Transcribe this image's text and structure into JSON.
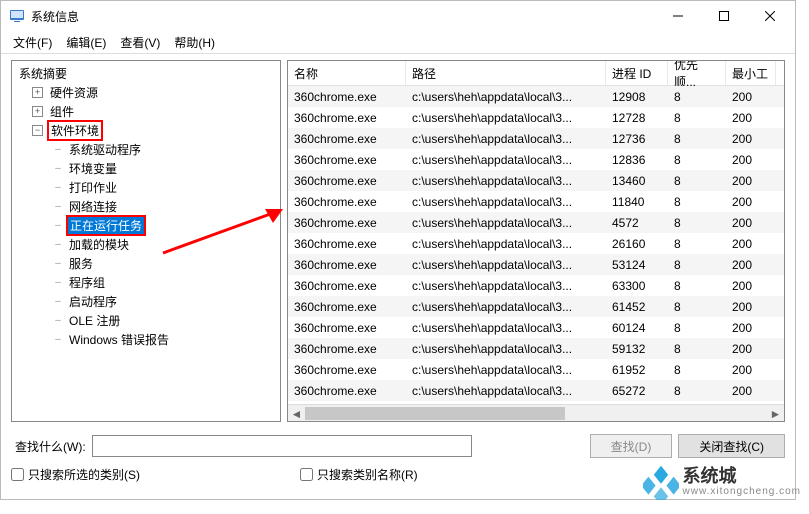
{
  "window": {
    "title": "系统信息"
  },
  "menu": {
    "file": "文件(F)",
    "edit": "编辑(E)",
    "view": "查看(V)",
    "help": "帮助(H)"
  },
  "tree": {
    "root": "系统摘要",
    "hw": "硬件资源",
    "comp": "组件",
    "swenv": "软件环境",
    "subs": {
      "drivers": "系统驱动程序",
      "env": "环境变量",
      "print": "打印作业",
      "net": "网络连接",
      "tasks": "正在运行任务",
      "modules": "加载的模块",
      "services": "服务",
      "groups": "程序组",
      "startup": "启动程序",
      "ole": "OLE 注册",
      "werr": "Windows 错误报告"
    }
  },
  "columns": {
    "name": "名称",
    "path": "路径",
    "pid": "进程 ID",
    "prio": "优先顺...",
    "min": "最小工"
  },
  "rows": [
    {
      "name": "360chrome.exe",
      "path": "c:\\users\\heh\\appdata\\local\\3...",
      "pid": "12908",
      "prio": "8",
      "min": "200"
    },
    {
      "name": "360chrome.exe",
      "path": "c:\\users\\heh\\appdata\\local\\3...",
      "pid": "12728",
      "prio": "8",
      "min": "200"
    },
    {
      "name": "360chrome.exe",
      "path": "c:\\users\\heh\\appdata\\local\\3...",
      "pid": "12736",
      "prio": "8",
      "min": "200"
    },
    {
      "name": "360chrome.exe",
      "path": "c:\\users\\heh\\appdata\\local\\3...",
      "pid": "12836",
      "prio": "8",
      "min": "200"
    },
    {
      "name": "360chrome.exe",
      "path": "c:\\users\\heh\\appdata\\local\\3...",
      "pid": "13460",
      "prio": "8",
      "min": "200"
    },
    {
      "name": "360chrome.exe",
      "path": "c:\\users\\heh\\appdata\\local\\3...",
      "pid": "11840",
      "prio": "8",
      "min": "200"
    },
    {
      "name": "360chrome.exe",
      "path": "c:\\users\\heh\\appdata\\local\\3...",
      "pid": "4572",
      "prio": "8",
      "min": "200"
    },
    {
      "name": "360chrome.exe",
      "path": "c:\\users\\heh\\appdata\\local\\3...",
      "pid": "26160",
      "prio": "8",
      "min": "200"
    },
    {
      "name": "360chrome.exe",
      "path": "c:\\users\\heh\\appdata\\local\\3...",
      "pid": "53124",
      "prio": "8",
      "min": "200"
    },
    {
      "name": "360chrome.exe",
      "path": "c:\\users\\heh\\appdata\\local\\3...",
      "pid": "63300",
      "prio": "8",
      "min": "200"
    },
    {
      "name": "360chrome.exe",
      "path": "c:\\users\\heh\\appdata\\local\\3...",
      "pid": "61452",
      "prio": "8",
      "min": "200"
    },
    {
      "name": "360chrome.exe",
      "path": "c:\\users\\heh\\appdata\\local\\3...",
      "pid": "60124",
      "prio": "8",
      "min": "200"
    },
    {
      "name": "360chrome.exe",
      "path": "c:\\users\\heh\\appdata\\local\\3...",
      "pid": "59132",
      "prio": "8",
      "min": "200"
    },
    {
      "name": "360chrome.exe",
      "path": "c:\\users\\heh\\appdata\\local\\3...",
      "pid": "61952",
      "prio": "8",
      "min": "200"
    },
    {
      "name": "360chrome.exe",
      "path": "c:\\users\\heh\\appdata\\local\\3...",
      "pid": "65272",
      "prio": "8",
      "min": "200"
    }
  ],
  "footer": {
    "search_label": "查找什么(W):",
    "find_btn": "查找(D)",
    "close_find_btn": "关闭查找(C)",
    "only_selected": "只搜索所选的类别(S)",
    "only_catname": "只搜索类别名称(R)"
  },
  "watermark": {
    "name": "系统城",
    "url": "www.xitongcheng.com"
  }
}
